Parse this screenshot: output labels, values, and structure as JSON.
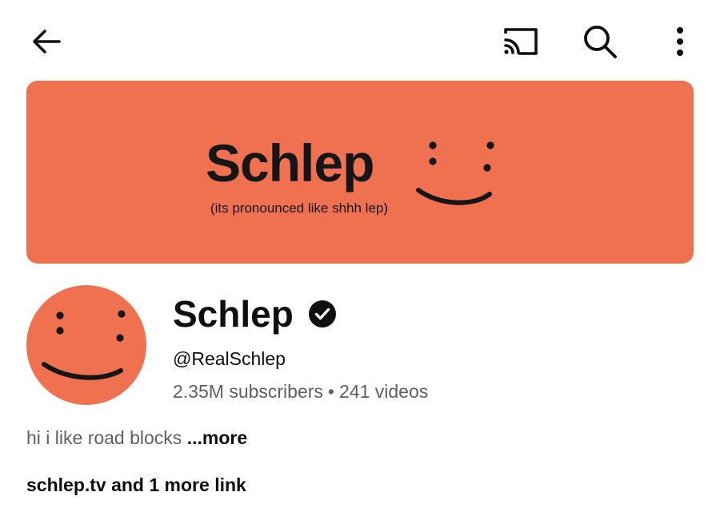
{
  "topbar": {
    "icons": [
      "back-arrow-icon",
      "cast-icon",
      "search-icon",
      "more-vertical-icon"
    ]
  },
  "banner": {
    "title": "Schlep",
    "subtitle": "(its pronounced like shhh lep)",
    "background": "#f07150"
  },
  "channel": {
    "name": "Schlep",
    "verified": true,
    "handle": "@RealSchlep",
    "subscribers": "2.35M subscribers",
    "separator": "•",
    "videos": "241 videos",
    "description": "hi i like road blocks ",
    "more_label": "...more",
    "links": "schlep.tv and 1 more link",
    "accent": "#f07150"
  }
}
